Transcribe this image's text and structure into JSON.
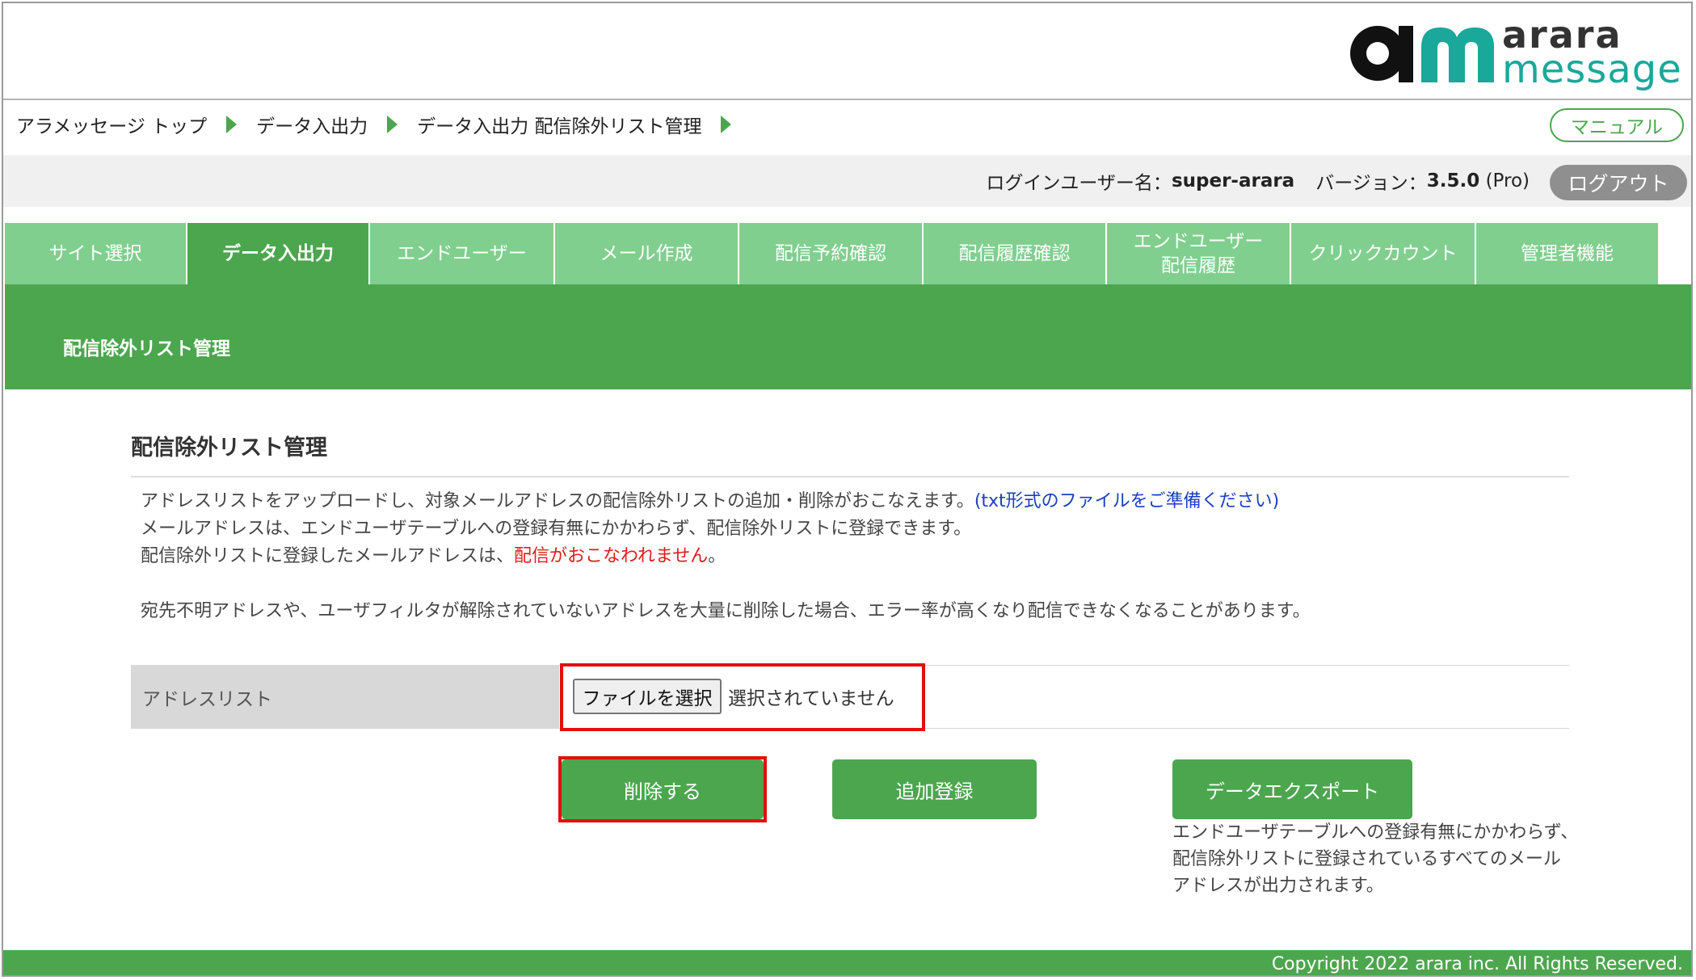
{
  "logo": {
    "word1": "arara",
    "word2": "message",
    "mark_color": "#1aa89a"
  },
  "breadcrumb": [
    "アラメッセージ トップ",
    "データ入出力",
    "データ入出力 配信除外リスト管理"
  ],
  "header": {
    "manual_label": "マニュアル",
    "login_label": "ログインユーザー名：",
    "login_user": "super-arara",
    "version_label": "バージョン：",
    "version_number": "3.5.0",
    "version_edition": "(Pro)",
    "logout_label": "ログアウト"
  },
  "tabs": [
    {
      "label": "サイト選択",
      "active": false
    },
    {
      "label": "データ入出力",
      "active": true
    },
    {
      "label": "エンドユーザー",
      "active": false
    },
    {
      "label": "メール作成",
      "active": false
    },
    {
      "label": "配信予約確認",
      "active": false
    },
    {
      "label": "配信履歴確認",
      "active": false
    },
    {
      "label_line1": "エンドユーザー",
      "label_line2": "配信履歴",
      "active": false
    },
    {
      "label": "クリックカウント",
      "active": false
    },
    {
      "label": "管理者機能",
      "active": false
    }
  ],
  "section_title": "配信除外リスト管理",
  "content": {
    "title": "配信除外リスト管理",
    "desc1": "アドレスリストをアップロードし、対象メールアドレスの配信除外リストの追加・削除がおこなえます。",
    "desc1_link": "(txt形式のファイルをご準備ください)",
    "desc2": "メールアドレスは、エンドユーザテーブルへの登録有無にかかわらず、配信除外リストに登録できます。",
    "desc3": "配信除外リストに登録したメールアドレスは、",
    "desc3_red": "配信がおこなわれません",
    "desc3_end": "。",
    "warning": "宛先不明アドレスや、ユーザフィルタが解除されていないアドレスを大量に削除した場合、エラー率が高くなり配信できなくなることがあります。"
  },
  "form": {
    "address_label": "アドレスリスト",
    "file_button": "ファイルを選択",
    "file_status": "選択されていません"
  },
  "actions": {
    "delete": "削除する",
    "add": "追加登録",
    "export": "データエクスポート",
    "export_note_line1": "エンドユーザテーブルへの登録有無にかかわらず、",
    "export_note_line2": "配信除外リストに登録されているすべてのメール",
    "export_note_line3": "アドレスが出力されます。"
  },
  "footer": {
    "copyright": "Copyright 2022 arara inc. All Rights Reserved."
  },
  "colors": {
    "brand_green": "#4ca64e",
    "tab_light": "#80cf8e",
    "highlight": "#e20f0f"
  }
}
